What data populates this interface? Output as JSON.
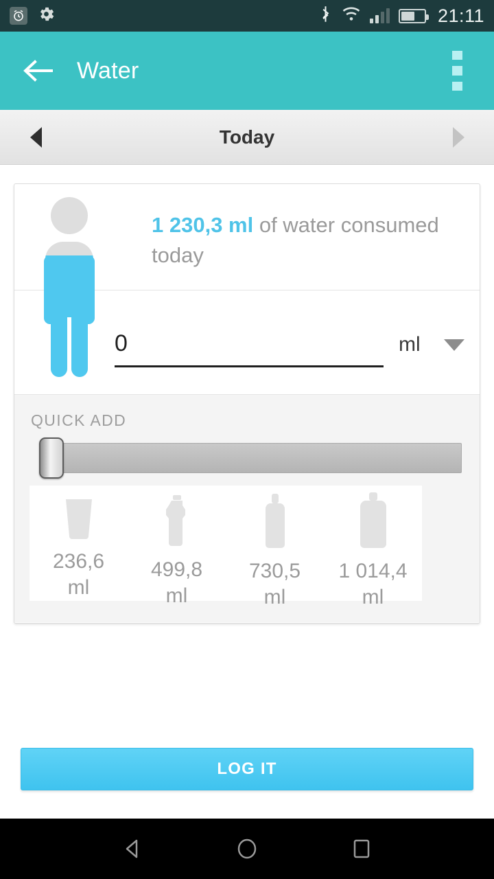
{
  "statusbar": {
    "time": "21:11",
    "icons": [
      "alarm-icon",
      "gear-icon",
      "bluetooth-icon",
      "wifi-icon",
      "signal-icon",
      "battery-icon"
    ],
    "battery_percent": 60,
    "signal_bars_filled": 2
  },
  "appbar": {
    "title": "Water",
    "back_icon": "arrow-left-icon",
    "overflow_icon": "more-vertical-icon",
    "background": "#3cc2c4"
  },
  "datebar": {
    "label": "Today",
    "prev_icon": "triangle-left-icon",
    "next_icon": "triangle-right-icon"
  },
  "summary": {
    "amount": "1 230,3 ml",
    "suffix": " of water consumed today",
    "figure_icon": "person-water-fill-icon",
    "fill_percent": 78,
    "accent_color": "#4fc3e8",
    "text_color": "#9a9a9a"
  },
  "input": {
    "value": "0",
    "placeholder": "0",
    "unit": "ml",
    "unit_caret_icon": "caret-down-icon"
  },
  "quick_add": {
    "label": "QUICK ADD",
    "slider": {
      "value": 0,
      "thumb_icon": "slider-thumb"
    },
    "items": [
      {
        "icon": "cup-icon",
        "value": "236,6",
        "unit": "ml"
      },
      {
        "icon": "sports-bottle-icon",
        "value": "499,8",
        "unit": "ml"
      },
      {
        "icon": "bottle-icon",
        "value": "730,5",
        "unit": "ml"
      },
      {
        "icon": "large-bottle-icon",
        "value": "1 014,4",
        "unit": "ml"
      }
    ]
  },
  "log_button": {
    "label": "LOG IT",
    "color": "#3fc3ef"
  },
  "navbar": {
    "back_icon": "nav-back-icon",
    "home_icon": "nav-home-icon",
    "recents_icon": "nav-recents-icon"
  }
}
